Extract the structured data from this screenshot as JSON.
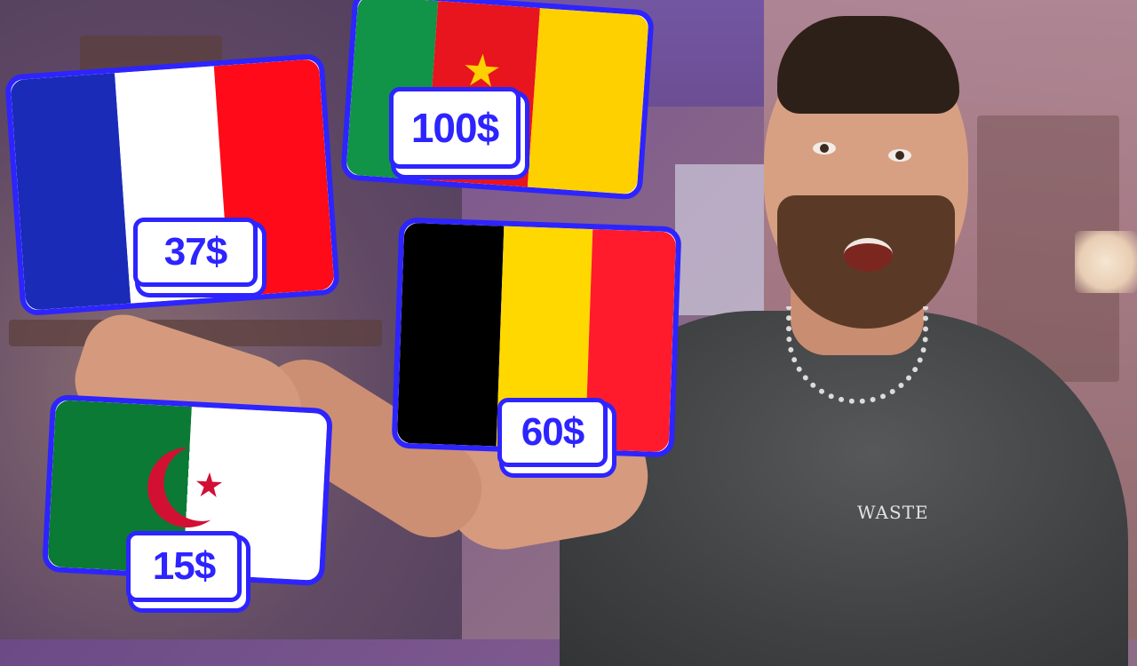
{
  "thumbnail": {
    "flags": [
      {
        "country": "France",
        "price": "37$",
        "colors": [
          "#1a2bb8",
          "#ffffff",
          "#ff0a18"
        ]
      },
      {
        "country": "Cameroon",
        "price": "100$",
        "colors": [
          "#119447",
          "#e8141e",
          "#ffd000"
        ]
      },
      {
        "country": "Belgium",
        "price": "60$",
        "colors": [
          "#000000",
          "#ffd800",
          "#ff1b2c"
        ]
      },
      {
        "country": "Algeria",
        "price": "15$",
        "colors": [
          "#0a7a35",
          "#ffffff",
          "#d21034"
        ]
      }
    ],
    "shirt_logo": "WASTE",
    "accent_color": "#2d24ff"
  }
}
